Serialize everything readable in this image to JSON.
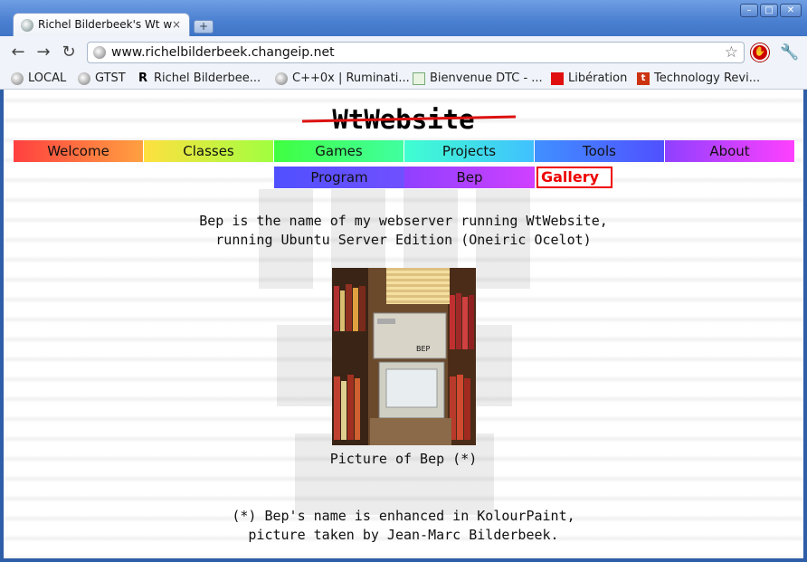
{
  "browser": {
    "tab_title": "Richel Bilderbeek's Wt we",
    "tab_close": "×",
    "new_tab": "+",
    "window_buttons": [
      "–",
      "□",
      "✕"
    ],
    "url": "www.richelbilderbeek.changeip.net",
    "nav": {
      "back": "←",
      "forward": "→",
      "reload": "↻"
    },
    "star": "☆",
    "wrench": "🔧",
    "bookmarks": [
      {
        "label": "LOCAL",
        "icon": "globe-icon"
      },
      {
        "label": "GTST",
        "icon": "globe-icon"
      },
      {
        "label": "Richel Bilderbee...",
        "icon": "rb-logo-icon"
      },
      {
        "label": "C++0x | Ruminati...",
        "icon": "globe-icon"
      },
      {
        "label": "Bienvenue DTC - ...",
        "icon": "dtc-icon"
      },
      {
        "label": "Libération",
        "icon": "liberation-icon"
      },
      {
        "label": "Technology Revi...",
        "icon": "tr-logo-icon"
      }
    ]
  },
  "page": {
    "site_title": "WtWebsite",
    "menu_top": [
      "Welcome",
      "Classes",
      "Games",
      "Projects",
      "Tools",
      "About"
    ],
    "menu_sub": [
      "Program",
      "Bep",
      "Gallery"
    ],
    "selected_sub": "Gallery",
    "intro_lines": [
      "Bep is the name of my webserver running WtWebsite,",
      "running Ubuntu Server Edition (Oneiric Ocelot)"
    ],
    "photo_label": "BEP",
    "caption": "Picture of Bep (*)",
    "footnote_lines": [
      "(*) Bep's name is enhanced in KolourPaint,",
      "picture taken by Jean-Marc Bilderbeek."
    ]
  },
  "colors": {
    "accent_red": "#e00000",
    "title_strike": "#d11111",
    "chrome_blue": "#4a7fd0"
  }
}
